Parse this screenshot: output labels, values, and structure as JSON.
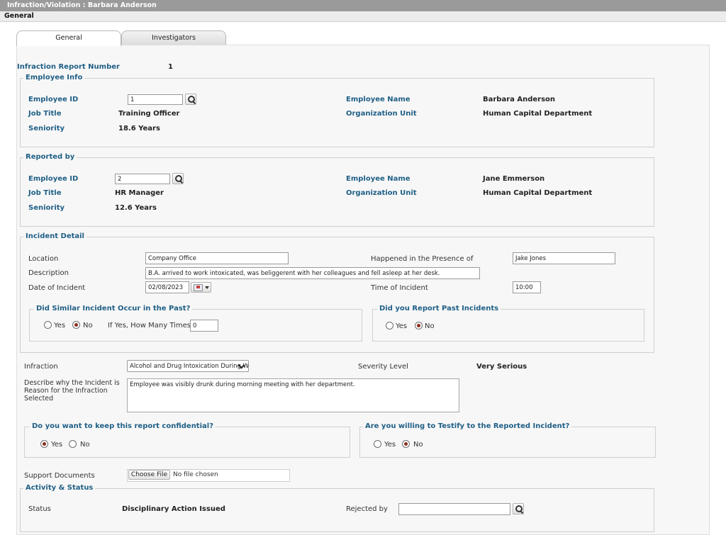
{
  "window": {
    "title": "Infraction/Violation : Barbara Anderson",
    "subtitle": "General"
  },
  "tabs": [
    {
      "label": "General"
    },
    {
      "label": "Investigators"
    }
  ],
  "report": {
    "number_label": "Infraction Report Number",
    "number_value": "1"
  },
  "employee_info": {
    "legend": "Employee Info",
    "id_label": "Employee ID",
    "id_value": "1",
    "name_label": "Employee Name",
    "name_value": "Barbara Anderson",
    "job_label": "Job Title",
    "job_value": "Training Officer",
    "org_label": "Organization Unit",
    "org_value": "Human Capital Department",
    "seniority_label": "Seniority",
    "seniority_value": "18.6 Years"
  },
  "reported_by": {
    "legend": "Reported by",
    "id_label": "Employee ID",
    "id_value": "2",
    "name_label": "Employee Name",
    "name_value": "Jane Emmerson",
    "job_label": "Job Title",
    "job_value": "HR Manager",
    "org_label": "Organization Unit",
    "org_value": "Human Capital Department",
    "seniority_label": "Seniority",
    "seniority_value": "12.6 Years"
  },
  "incident": {
    "legend": "Incident Detail",
    "location_label": "Location",
    "location_value": "Company Office",
    "presence_label": "Happened in the Presence of",
    "presence_value": "Jake Jones",
    "description_label": "Description",
    "description_value": "B.A. arrived to work intoxicated, was beliggerent with her colleagues and fell asleep at her desk.",
    "date_label": "Date of Incident",
    "date_value": "02/08/2023",
    "time_label": "Time of Incident",
    "time_value": "10:00",
    "similar": {
      "legend": "Did Similar Incident Occur in the Past?",
      "yes_label": "Yes",
      "no_label": "No",
      "times_label": "If Yes, How Many Times?",
      "times_value": "0"
    },
    "report_past": {
      "legend": "Did you Report Past Incidents",
      "yes_label": "Yes",
      "no_label": "No"
    }
  },
  "infraction": {
    "label": "Infraction",
    "selected": "Alcohol and Drug Intoxication During Work",
    "severity_label": "Severity Level",
    "severity_value": "Very Serious",
    "reason_label": "Describe why the Incident is Reason for the Infraction Selected",
    "reason_value": "Employee was visibly drunk during morning meeting with her department."
  },
  "confidential": {
    "legend": "Do you want to keep this report confidential?",
    "yes_label": "Yes",
    "no_label": "No"
  },
  "testify": {
    "legend": "Are you willing to Testify to the Reported Incident?",
    "yes_label": "Yes",
    "no_label": "No"
  },
  "documents": {
    "label": "Support Documents",
    "button_label": "Choose File",
    "status": "No file chosen"
  },
  "activity": {
    "legend": "Activity & Status",
    "status_label": "Status",
    "status_value": "Disciplinary Action Issued",
    "rejected_label": "Rejected by",
    "rejected_value": ""
  }
}
